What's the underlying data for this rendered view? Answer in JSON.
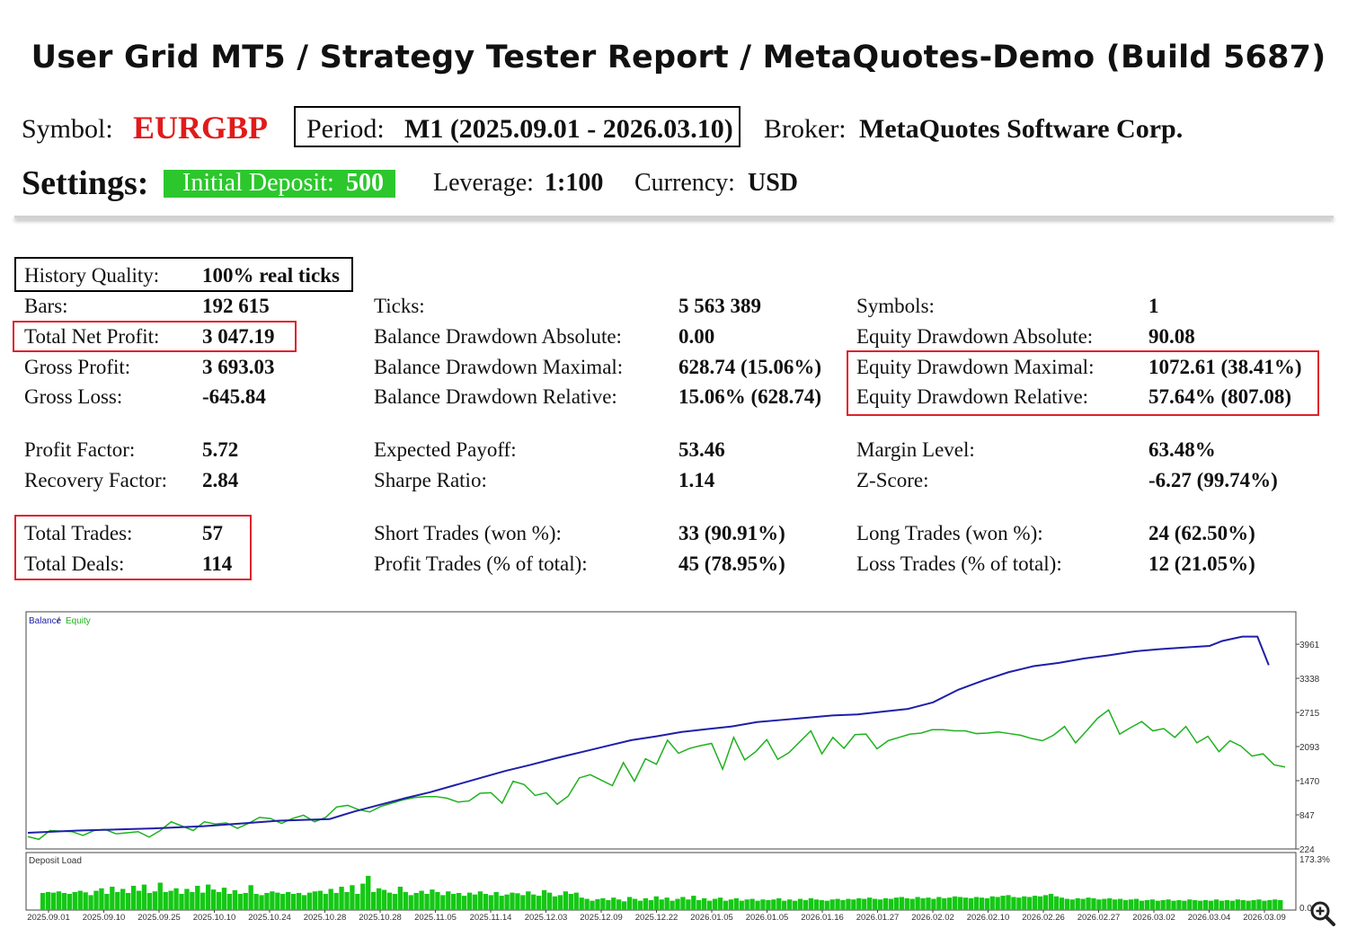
{
  "header": {
    "title": "User Grid MT5  /  Strategy Tester Report  /  MetaQuotes-Demo (Build 5687)",
    "symbol_label": "Symbol:",
    "symbol_value": "EURGBP",
    "period_label": "Period:",
    "period_value": "M1 (2025.09.01 - 2026.03.10)",
    "broker_label": "Broker:",
    "broker_value": "MetaQuotes Software Corp.",
    "settings_label": "Settings:",
    "deposit_label": "Initial Deposit:",
    "deposit_value": "500",
    "leverage_label": "Leverage:",
    "leverage_value": "1:100",
    "currency_label": "Currency:",
    "currency_value": "USD"
  },
  "stats": {
    "history_quality": {
      "label": "History Quality:",
      "value": "100% real ticks"
    },
    "bars": {
      "label": "Bars:",
      "value": "192 615"
    },
    "total_net_profit": {
      "label": "Total Net Profit:",
      "value": "3 047.19"
    },
    "gross_profit": {
      "label": "Gross Profit:",
      "value": "3 693.03"
    },
    "gross_loss": {
      "label": "Gross Loss:",
      "value": "-645.84"
    },
    "profit_factor": {
      "label": "Profit Factor:",
      "value": "5.72"
    },
    "recovery_factor": {
      "label": "Recovery Factor:",
      "value": "2.84"
    },
    "total_trades": {
      "label": "Total Trades:",
      "value": "57"
    },
    "total_deals": {
      "label": "Total Deals:",
      "value": "114"
    },
    "ticks": {
      "label": "Ticks:",
      "value": "5 563 389"
    },
    "balance_dd_abs": {
      "label": "Balance Drawdown Absolute:",
      "value": "0.00"
    },
    "balance_dd_max": {
      "label": "Balance Drawdown Maximal:",
      "value": "628.74 (15.06%)"
    },
    "balance_dd_rel": {
      "label": "Balance Drawdown Relative:",
      "value": "15.06% (628.74)"
    },
    "expected_payoff": {
      "label": "Expected Payoff:",
      "value": "53.46"
    },
    "sharpe_ratio": {
      "label": "Sharpe Ratio:",
      "value": "1.14"
    },
    "short_trades": {
      "label": "Short Trades (won %):",
      "value": "33 (90.91%)"
    },
    "profit_trades": {
      "label": "Profit Trades (% of total):",
      "value": "45 (78.95%)"
    },
    "symbols": {
      "label": "Symbols:",
      "value": "1"
    },
    "equity_dd_abs": {
      "label": "Equity Drawdown Absolute:",
      "value": "90.08"
    },
    "equity_dd_max": {
      "label": "Equity Drawdown Maximal:",
      "value": "1072.61 (38.41%)"
    },
    "equity_dd_rel": {
      "label": "Equity Drawdown Relative:",
      "value": "57.64% (807.08)"
    },
    "margin_level": {
      "label": "Margin Level:",
      "value": "63.48%"
    },
    "z_score": {
      "label": "Z-Score:",
      "value": "-6.27 (99.74%)"
    },
    "long_trades": {
      "label": "Long Trades (won %):",
      "value": "24 (62.50%)"
    },
    "loss_trades": {
      "label": "Loss Trades (% of total):",
      "value": "12 (21.05%)"
    }
  },
  "colors": {
    "title_text": "#111111",
    "symbol": "#e01b1b",
    "deposit_bg": "#2cc72c",
    "highlight_red": "#e0202a",
    "balance_line": "#1f1fa8",
    "equity_line": "#1fb21f",
    "deposit_bars": "#14c814"
  },
  "icons": {
    "zoom": "zoom-in-icon"
  },
  "chart_data": [
    {
      "type": "line",
      "legend": {
        "balance": "Balance",
        "separator": " / ",
        "equity": "Equity",
        "placement": "top-left"
      },
      "yticks": [
        "224",
        "847",
        "1470",
        "2093",
        "2715",
        "3338",
        "3961"
      ],
      "ylim": [
        224,
        4200
      ],
      "xlim": [
        0,
        100
      ],
      "series": [
        {
          "name": "Balance",
          "color": "#1f1fa8",
          "points": [
            [
              0,
              520
            ],
            [
              4,
              560
            ],
            [
              10,
              600
            ],
            [
              14,
              640
            ],
            [
              17,
              690
            ],
            [
              20,
              740
            ],
            [
              24,
              770
            ],
            [
              26,
              910
            ],
            [
              28,
              1030
            ],
            [
              30,
              1150
            ],
            [
              32,
              1260
            ],
            [
              34,
              1390
            ],
            [
              36,
              1520
            ],
            [
              38,
              1650
            ],
            [
              40,
              1760
            ],
            [
              42,
              1880
            ],
            [
              44,
              1990
            ],
            [
              46,
              2100
            ],
            [
              48,
              2210
            ],
            [
              50,
              2280
            ],
            [
              52,
              2360
            ],
            [
              54,
              2410
            ],
            [
              56,
              2460
            ],
            [
              58,
              2540
            ],
            [
              60,
              2580
            ],
            [
              62,
              2620
            ],
            [
              64,
              2660
            ],
            [
              66,
              2680
            ],
            [
              68,
              2730
            ],
            [
              70,
              2780
            ],
            [
              72,
              2900
            ],
            [
              74,
              3130
            ],
            [
              76,
              3300
            ],
            [
              78,
              3450
            ],
            [
              80,
              3560
            ],
            [
              82,
              3620
            ],
            [
              84,
              3700
            ],
            [
              86,
              3760
            ],
            [
              88,
              3830
            ],
            [
              90,
              3870
            ],
            [
              92,
              3900
            ],
            [
              94,
              3930
            ],
            [
              95,
              4020
            ],
            [
              96.6,
              4100
            ],
            [
              97.8,
              4100
            ],
            [
              98.7,
              3580
            ]
          ]
        },
        {
          "name": "Equity",
          "color": "#1fb21f",
          "points": [
            [
              0,
              450
            ],
            [
              1,
              400
            ],
            [
              2,
              560
            ],
            [
              4,
              540
            ],
            [
              5,
              470
            ],
            [
              6,
              560
            ],
            [
              7,
              580
            ],
            [
              8,
              500
            ],
            [
              9,
              520
            ],
            [
              10,
              540
            ],
            [
              11,
              440
            ],
            [
              12,
              560
            ],
            [
              13,
              720
            ],
            [
              14,
              640
            ],
            [
              15,
              560
            ],
            [
              16,
              720
            ],
            [
              17,
              680
            ],
            [
              18,
              700
            ],
            [
              19,
              600
            ],
            [
              20,
              690
            ],
            [
              21,
              800
            ],
            [
              22,
              780
            ],
            [
              23,
              690
            ],
            [
              24,
              780
            ],
            [
              25,
              840
            ],
            [
              26,
              720
            ],
            [
              27,
              800
            ],
            [
              28,
              990
            ],
            [
              29,
              1020
            ],
            [
              30,
              940
            ],
            [
              31,
              900
            ],
            [
              32,
              1000
            ],
            [
              33,
              1060
            ],
            [
              34,
              1120
            ],
            [
              35,
              1160
            ],
            [
              36,
              1180
            ],
            [
              37,
              1180
            ],
            [
              38,
              1150
            ],
            [
              39,
              1080
            ],
            [
              40,
              1100
            ],
            [
              41,
              1240
            ],
            [
              42,
              1250
            ],
            [
              43,
              1060
            ],
            [
              44,
              1460
            ],
            [
              45,
              1400
            ],
            [
              46,
              1200
            ],
            [
              47,
              1250
            ],
            [
              48,
              1040
            ],
            [
              49,
              1190
            ],
            [
              50,
              1520
            ],
            [
              51,
              1580
            ],
            [
              52,
              1480
            ],
            [
              53,
              1380
            ],
            [
              54,
              1800
            ],
            [
              55,
              1460
            ],
            [
              56,
              1870
            ],
            [
              57,
              1770
            ],
            [
              58,
              2210
            ],
            [
              59,
              1970
            ],
            [
              60,
              2060
            ],
            [
              61,
              2110
            ],
            [
              62,
              2150
            ],
            [
              63,
              1680
            ],
            [
              64,
              2260
            ],
            [
              65,
              1850
            ],
            [
              66,
              2000
            ],
            [
              67,
              2220
            ],
            [
              68,
              1860
            ],
            [
              69,
              1980
            ],
            [
              70,
              2180
            ],
            [
              71,
              2380
            ],
            [
              72,
              1960
            ],
            [
              73,
              2260
            ],
            [
              74,
              2060
            ],
            [
              75,
              2310
            ],
            [
              76,
              2320
            ],
            [
              77,
              2050
            ],
            [
              78,
              2200
            ],
            [
              79,
              2260
            ],
            [
              80,
              2320
            ],
            [
              81,
              2340
            ],
            [
              82,
              2400
            ],
            [
              83,
              2400
            ],
            [
              84,
              2380
            ],
            [
              85,
              2380
            ],
            [
              86,
              2330
            ],
            [
              87,
              2340
            ],
            [
              88,
              2360
            ],
            [
              89,
              2330
            ],
            [
              90,
              2300
            ],
            [
              91,
              2240
            ],
            [
              92,
              2200
            ],
            [
              93,
              2300
            ],
            [
              94,
              2460
            ],
            [
              95,
              2160
            ],
            [
              96,
              2380
            ],
            [
              97,
              2610
            ],
            [
              98,
              2760
            ],
            [
              99,
              2320
            ],
            [
              100,
              2440
            ],
            [
              101,
              2550
            ],
            [
              102,
              2380
            ],
            [
              103,
              2420
            ],
            [
              104,
              2260
            ],
            [
              105,
              2460
            ],
            [
              106,
              2160
            ],
            [
              107,
              2280
            ],
            [
              108,
              2000
            ],
            [
              109,
              2200
            ],
            [
              110,
              2100
            ],
            [
              111,
              1920
            ],
            [
              112,
              1960
            ],
            [
              113,
              1760
            ],
            [
              114,
              1720
            ]
          ]
        }
      ],
      "x_categories": [
        "2025.09.01",
        "2025.09.10",
        "2025.09.25",
        "2025.10.10",
        "2025.10.24",
        "2025.10.28",
        "2025.10.28",
        "2025.11.05",
        "2025.11.14",
        "2025.12.03",
        "2025.12.09",
        "2025.12.22",
        "2026.01.05",
        "2026.01.05",
        "2026.01.16",
        "2026.01.27",
        "2026.02.02",
        "2026.02.10",
        "2026.02.26",
        "2026.02.27",
        "2026.03.02",
        "2026.03.04",
        "2026.03.09"
      ]
    },
    {
      "type": "bar",
      "title": "Deposit Load",
      "yticks": [
        "173.3%",
        "0.0%"
      ],
      "ylim": [
        0,
        173.3
      ],
      "color": "#14c814",
      "values": [
        55,
        58,
        56,
        60,
        55,
        52,
        58,
        62,
        57,
        48,
        62,
        70,
        52,
        75,
        58,
        68,
        55,
        78,
        62,
        82,
        55,
        60,
        88,
        58,
        62,
        70,
        52,
        68,
        58,
        78,
        56,
        82,
        66,
        58,
        72,
        52,
        64,
        52,
        55,
        80,
        52,
        48,
        55,
        60,
        56,
        52,
        58,
        52,
        55,
        48,
        56,
        60,
        62,
        52,
        68,
        55,
        75,
        58,
        80,
        52,
        85,
        110,
        58,
        70,
        65,
        56,
        52,
        75,
        58,
        48,
        55,
        62,
        52,
        66,
        58,
        48,
        60,
        52,
        55,
        46,
        56,
        50,
        60,
        52,
        48,
        58,
        46,
        50,
        56,
        54,
        48,
        60,
        50,
        46,
        64,
        56,
        44,
        48,
        60,
        52,
        56,
        40,
        36,
        30,
        35,
        38,
        32,
        40,
        34,
        28,
        42,
        36,
        30,
        38,
        32,
        44,
        34,
        40,
        30,
        36,
        42,
        34,
        46,
        32,
        38,
        30,
        36,
        40,
        30,
        34,
        38,
        30,
        34,
        36,
        30,
        34,
        32,
        34,
        38,
        30,
        34,
        30,
        36,
        32,
        38,
        34,
        32,
        30,
        34,
        36,
        32,
        36,
        34,
        38,
        36,
        40,
        36,
        34,
        38,
        36,
        40,
        42,
        38,
        36,
        42,
        38,
        40,
        36,
        42,
        38,
        40,
        44,
        42,
        40,
        38,
        42,
        40,
        38,
        44,
        42,
        46,
        48,
        42,
        40,
        44,
        42,
        46,
        44,
        48,
        52,
        44,
        40,
        36,
        34,
        38,
        36,
        40,
        38,
        34,
        36,
        38,
        34,
        36,
        32,
        34,
        36,
        30,
        32,
        34,
        30,
        32,
        34,
        30,
        32,
        30,
        34,
        32,
        30,
        32,
        30,
        34,
        30,
        32,
        30,
        34,
        32,
        30,
        32,
        34,
        30,
        32,
        34,
        32
      ]
    }
  ]
}
